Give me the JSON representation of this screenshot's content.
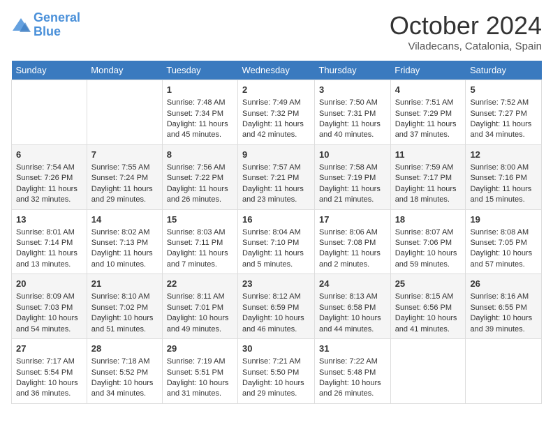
{
  "header": {
    "logo_line1": "General",
    "logo_line2": "Blue",
    "month": "October 2024",
    "location": "Viladecans, Catalonia, Spain"
  },
  "days_of_week": [
    "Sunday",
    "Monday",
    "Tuesday",
    "Wednesday",
    "Thursday",
    "Friday",
    "Saturday"
  ],
  "weeks": [
    [
      {
        "day": "",
        "info": ""
      },
      {
        "day": "",
        "info": ""
      },
      {
        "day": "1",
        "info": "Sunrise: 7:48 AM\nSunset: 7:34 PM\nDaylight: 11 hours and 45 minutes."
      },
      {
        "day": "2",
        "info": "Sunrise: 7:49 AM\nSunset: 7:32 PM\nDaylight: 11 hours and 42 minutes."
      },
      {
        "day": "3",
        "info": "Sunrise: 7:50 AM\nSunset: 7:31 PM\nDaylight: 11 hours and 40 minutes."
      },
      {
        "day": "4",
        "info": "Sunrise: 7:51 AM\nSunset: 7:29 PM\nDaylight: 11 hours and 37 minutes."
      },
      {
        "day": "5",
        "info": "Sunrise: 7:52 AM\nSunset: 7:27 PM\nDaylight: 11 hours and 34 minutes."
      }
    ],
    [
      {
        "day": "6",
        "info": "Sunrise: 7:54 AM\nSunset: 7:26 PM\nDaylight: 11 hours and 32 minutes."
      },
      {
        "day": "7",
        "info": "Sunrise: 7:55 AM\nSunset: 7:24 PM\nDaylight: 11 hours and 29 minutes."
      },
      {
        "day": "8",
        "info": "Sunrise: 7:56 AM\nSunset: 7:22 PM\nDaylight: 11 hours and 26 minutes."
      },
      {
        "day": "9",
        "info": "Sunrise: 7:57 AM\nSunset: 7:21 PM\nDaylight: 11 hours and 23 minutes."
      },
      {
        "day": "10",
        "info": "Sunrise: 7:58 AM\nSunset: 7:19 PM\nDaylight: 11 hours and 21 minutes."
      },
      {
        "day": "11",
        "info": "Sunrise: 7:59 AM\nSunset: 7:17 PM\nDaylight: 11 hours and 18 minutes."
      },
      {
        "day": "12",
        "info": "Sunrise: 8:00 AM\nSunset: 7:16 PM\nDaylight: 11 hours and 15 minutes."
      }
    ],
    [
      {
        "day": "13",
        "info": "Sunrise: 8:01 AM\nSunset: 7:14 PM\nDaylight: 11 hours and 13 minutes."
      },
      {
        "day": "14",
        "info": "Sunrise: 8:02 AM\nSunset: 7:13 PM\nDaylight: 11 hours and 10 minutes."
      },
      {
        "day": "15",
        "info": "Sunrise: 8:03 AM\nSunset: 7:11 PM\nDaylight: 11 hours and 7 minutes."
      },
      {
        "day": "16",
        "info": "Sunrise: 8:04 AM\nSunset: 7:10 PM\nDaylight: 11 hours and 5 minutes."
      },
      {
        "day": "17",
        "info": "Sunrise: 8:06 AM\nSunset: 7:08 PM\nDaylight: 11 hours and 2 minutes."
      },
      {
        "day": "18",
        "info": "Sunrise: 8:07 AM\nSunset: 7:06 PM\nDaylight: 10 hours and 59 minutes."
      },
      {
        "day": "19",
        "info": "Sunrise: 8:08 AM\nSunset: 7:05 PM\nDaylight: 10 hours and 57 minutes."
      }
    ],
    [
      {
        "day": "20",
        "info": "Sunrise: 8:09 AM\nSunset: 7:03 PM\nDaylight: 10 hours and 54 minutes."
      },
      {
        "day": "21",
        "info": "Sunrise: 8:10 AM\nSunset: 7:02 PM\nDaylight: 10 hours and 51 minutes."
      },
      {
        "day": "22",
        "info": "Sunrise: 8:11 AM\nSunset: 7:01 PM\nDaylight: 10 hours and 49 minutes."
      },
      {
        "day": "23",
        "info": "Sunrise: 8:12 AM\nSunset: 6:59 PM\nDaylight: 10 hours and 46 minutes."
      },
      {
        "day": "24",
        "info": "Sunrise: 8:13 AM\nSunset: 6:58 PM\nDaylight: 10 hours and 44 minutes."
      },
      {
        "day": "25",
        "info": "Sunrise: 8:15 AM\nSunset: 6:56 PM\nDaylight: 10 hours and 41 minutes."
      },
      {
        "day": "26",
        "info": "Sunrise: 8:16 AM\nSunset: 6:55 PM\nDaylight: 10 hours and 39 minutes."
      }
    ],
    [
      {
        "day": "27",
        "info": "Sunrise: 7:17 AM\nSunset: 5:54 PM\nDaylight: 10 hours and 36 minutes."
      },
      {
        "day": "28",
        "info": "Sunrise: 7:18 AM\nSunset: 5:52 PM\nDaylight: 10 hours and 34 minutes."
      },
      {
        "day": "29",
        "info": "Sunrise: 7:19 AM\nSunset: 5:51 PM\nDaylight: 10 hours and 31 minutes."
      },
      {
        "day": "30",
        "info": "Sunrise: 7:21 AM\nSunset: 5:50 PM\nDaylight: 10 hours and 29 minutes."
      },
      {
        "day": "31",
        "info": "Sunrise: 7:22 AM\nSunset: 5:48 PM\nDaylight: 10 hours and 26 minutes."
      },
      {
        "day": "",
        "info": ""
      },
      {
        "day": "",
        "info": ""
      }
    ]
  ]
}
